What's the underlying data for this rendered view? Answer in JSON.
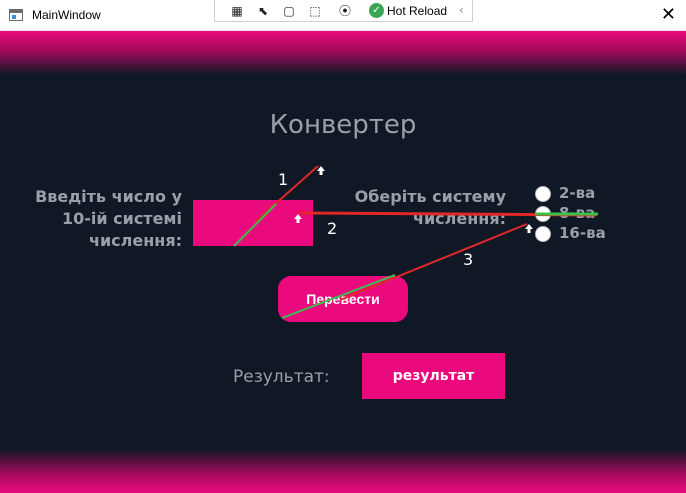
{
  "window": {
    "title": "MainWindow",
    "close_glyph": "✕"
  },
  "devtools": {
    "icons": [
      "live-visual-tree-icon",
      "select-element-icon",
      "display-layout-adorners-icon",
      "track-focus-icon",
      "binding-failures-icon"
    ],
    "hot_reload_label": "Hot Reload",
    "collapse_glyph": "‹"
  },
  "converter": {
    "heading": "Конвертер",
    "input_label_lines": [
      "Введіть число у",
      "10-ій системі",
      "числення:"
    ],
    "input_value": "",
    "system_label_lines": [
      "Оберіть систему",
      "числення:"
    ],
    "radio_options": [
      "2-ва",
      "8-ва",
      "16-ва"
    ],
    "convert_button": "Перевести",
    "result_label": "Результат:",
    "result_value": "результат"
  },
  "annotations": {
    "numbers": [
      "1",
      "2",
      "3"
    ]
  },
  "colors": {
    "accent": "#ea0a7e",
    "background": "#101826",
    "text_muted": "#9aa0a9",
    "annotation_red": "#e02828",
    "annotation_green": "#3cc04a"
  }
}
